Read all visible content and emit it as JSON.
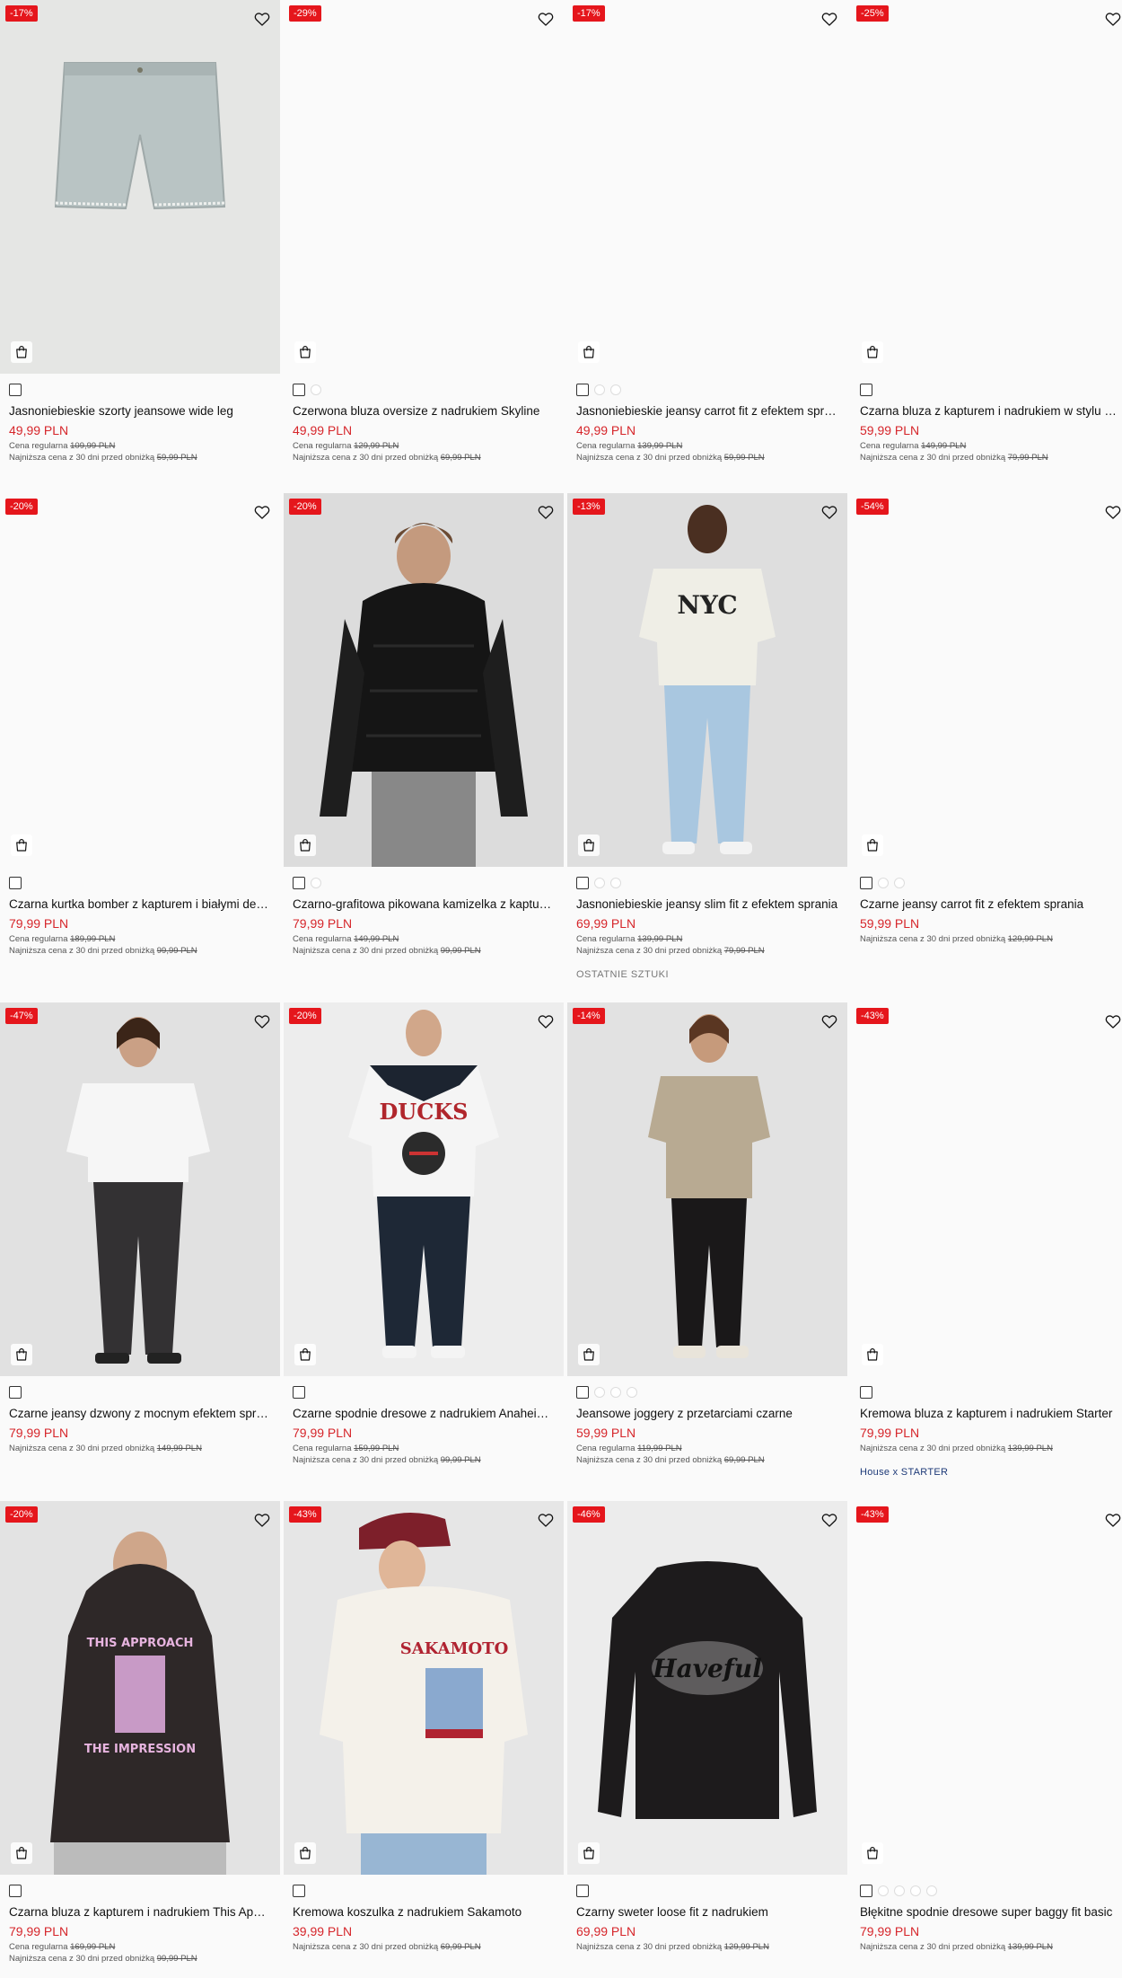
{
  "products": [
    {
      "discount": "-17%",
      "name": "Jasnoniebieskie szorty jeansowe wide leg",
      "price": "49,99 PLN",
      "regular_label": "Cena regularna",
      "regular": "109,99 PLN",
      "lowest_label": "Najniższa cena z 30 dni przed obniżką",
      "lowest": "59,99 PLN",
      "tag": "",
      "swatch_count": 1,
      "image": "denim-shorts"
    },
    {
      "discount": "-29%",
      "name": "Czerwona bluza oversize z nadrukiem Skyline",
      "price": "49,99 PLN",
      "regular_label": "Cena regularna",
      "regular": "129,99 PLN",
      "lowest_label": "Najniższa cena z 30 dni przed obniżką",
      "lowest": "69,99 PLN",
      "tag": "",
      "swatch_count": 2,
      "image": "blank"
    },
    {
      "discount": "-17%",
      "name": "Jasnoniebieskie jeansy carrot fit z efektem sprania",
      "price": "49,99 PLN",
      "regular_label": "Cena regularna",
      "regular": "139,99 PLN",
      "lowest_label": "Najniższa cena z 30 dni przed obniżką",
      "lowest": "59,99 PLN",
      "tag": "",
      "swatch_count": 3,
      "image": "blank"
    },
    {
      "discount": "-25%",
      "name": "Czarna bluza z kapturem i nadrukiem w stylu college",
      "price": "59,99 PLN",
      "regular_label": "Cena regularna",
      "regular": "149,99 PLN",
      "lowest_label": "Najniższa cena z 30 dni przed obniżką",
      "lowest": "79,99 PLN",
      "tag": "",
      "swatch_count": 1,
      "image": "blank"
    },
    {
      "discount": "-20%",
      "name": "Czarna kurtka bomber z kapturem i białymi detalami",
      "price": "79,99 PLN",
      "regular_label": "Cena regularna",
      "regular": "189,99 PLN",
      "lowest_label": "Najniższa cena z 30 dni przed obniżką",
      "lowest": "99,99 PLN",
      "tag": "",
      "swatch_count": 1,
      "image": "blank"
    },
    {
      "discount": "-20%",
      "name": "Czarno-grafitowa pikowana kamizelka z kapturem",
      "price": "79,99 PLN",
      "regular_label": "Cena regularna",
      "regular": "149,99 PLN",
      "lowest_label": "Najniższa cena z 30 dni przed obniżką",
      "lowest": "99,99 PLN",
      "tag": "",
      "swatch_count": 2,
      "image": "vest"
    },
    {
      "discount": "-13%",
      "name": "Jasnoniebieskie jeansy slim fit z efektem sprania",
      "price": "69,99 PLN",
      "regular_label": "Cena regularna",
      "regular": "139,99 PLN",
      "lowest_label": "Najniższa cena z 30 dni przed obniżką",
      "lowest": "79,99 PLN",
      "tag": "OSTATNIE SZTUKI",
      "swatch_count": 3,
      "image": "nyc"
    },
    {
      "discount": "-54%",
      "name": "Czarne jeansy carrot fit z efektem sprania",
      "price": "59,99 PLN",
      "regular_label": "",
      "regular": "",
      "lowest_label": "Najniższa cena z 30 dni przed obniżką",
      "lowest": "129,99 PLN",
      "tag": "",
      "swatch_count": 3,
      "image": "blank"
    },
    {
      "discount": "-47%",
      "name": "Czarne jeansy dzwony z mocnym efektem sprania",
      "price": "79,99 PLN",
      "regular_label": "",
      "regular": "",
      "lowest_label": "Najniższa cena z 30 dni przed obniżką",
      "lowest": "149,99 PLN",
      "tag": "",
      "swatch_count": 1,
      "image": "white-tee"
    },
    {
      "discount": "-20%",
      "name": "Czarne spodnie dresowe z nadrukiem Anaheim Ducks",
      "price": "79,99 PLN",
      "regular_label": "Cena regularna",
      "regular": "159,99 PLN",
      "lowest_label": "Najniższa cena z 30 dni przed obniżką",
      "lowest": "99,99 PLN",
      "tag": "",
      "swatch_count": 1,
      "image": "ducks"
    },
    {
      "discount": "-14%",
      "name": "Jeansowe joggery z przetarciami czarne",
      "price": "59,99 PLN",
      "regular_label": "Cena regularna",
      "regular": "119,99 PLN",
      "lowest_label": "Najniższa cena z 30 dni przed obniżką",
      "lowest": "69,99 PLN",
      "tag": "",
      "swatch_count": 4,
      "image": "beige-tee"
    },
    {
      "discount": "-43%",
      "name": "Kremowa bluza z kapturem i nadrukiem Starter",
      "price": "79,99 PLN",
      "regular_label": "",
      "regular": "",
      "lowest_label": "Najniższa cena z 30 dni przed obniżką",
      "lowest": "139,99 PLN",
      "tag": "House x STARTER",
      "swatch_count": 1,
      "image": "blank"
    },
    {
      "discount": "-20%",
      "name": "Czarna bluza z kapturem i nadrukiem This Approach",
      "price": "79,99 PLN",
      "regular_label": "Cena regularna",
      "regular": "169,99 PLN",
      "lowest_label": "Najniższa cena z 30 dni przed obniżką",
      "lowest": "99,99 PLN",
      "tag": "",
      "swatch_count": 1,
      "image": "hoodie"
    },
    {
      "discount": "-43%",
      "name": "Kremowa koszulka z nadrukiem Sakamoto",
      "price": "39,99 PLN",
      "regular_label": "",
      "regular": "",
      "lowest_label": "Najniższa cena z 30 dni przed obniżką",
      "lowest": "69,99 PLN",
      "tag": "",
      "swatch_count": 1,
      "image": "sakamoto"
    },
    {
      "discount": "-46%",
      "name": "Czarny sweter loose fit z nadrukiem",
      "price": "69,99 PLN",
      "regular_label": "",
      "regular": "",
      "lowest_label": "Najniższa cena z 30 dni przed obniżką",
      "lowest": "129,99 PLN",
      "tag": "",
      "swatch_count": 1,
      "image": "sweater"
    },
    {
      "discount": "-43%",
      "name": "Błękitne spodnie dresowe super baggy fit basic",
      "price": "79,99 PLN",
      "regular_label": "",
      "regular": "",
      "lowest_label": "Najniższa cena z 30 dni przed obniżką",
      "lowest": "139,99 PLN",
      "tag": "",
      "swatch_count": 5,
      "image": "blank"
    }
  ],
  "print_text": {
    "nyc": "NYC",
    "ducks": "DUCKS",
    "hoodie_top": "THIS APPROACH",
    "hoodie_bottom": "THE IMPRESSION",
    "sakamoto": "SAKAMOTO",
    "sweater": "Haveful"
  },
  "icons": {
    "wishlist": "heart-icon",
    "add_to_bag": "shopping-bag-icon"
  },
  "colors": {
    "discount_badge": "#e5161c",
    "sale_price": "#d6262b",
    "collab_tag": "#1e3a78"
  }
}
